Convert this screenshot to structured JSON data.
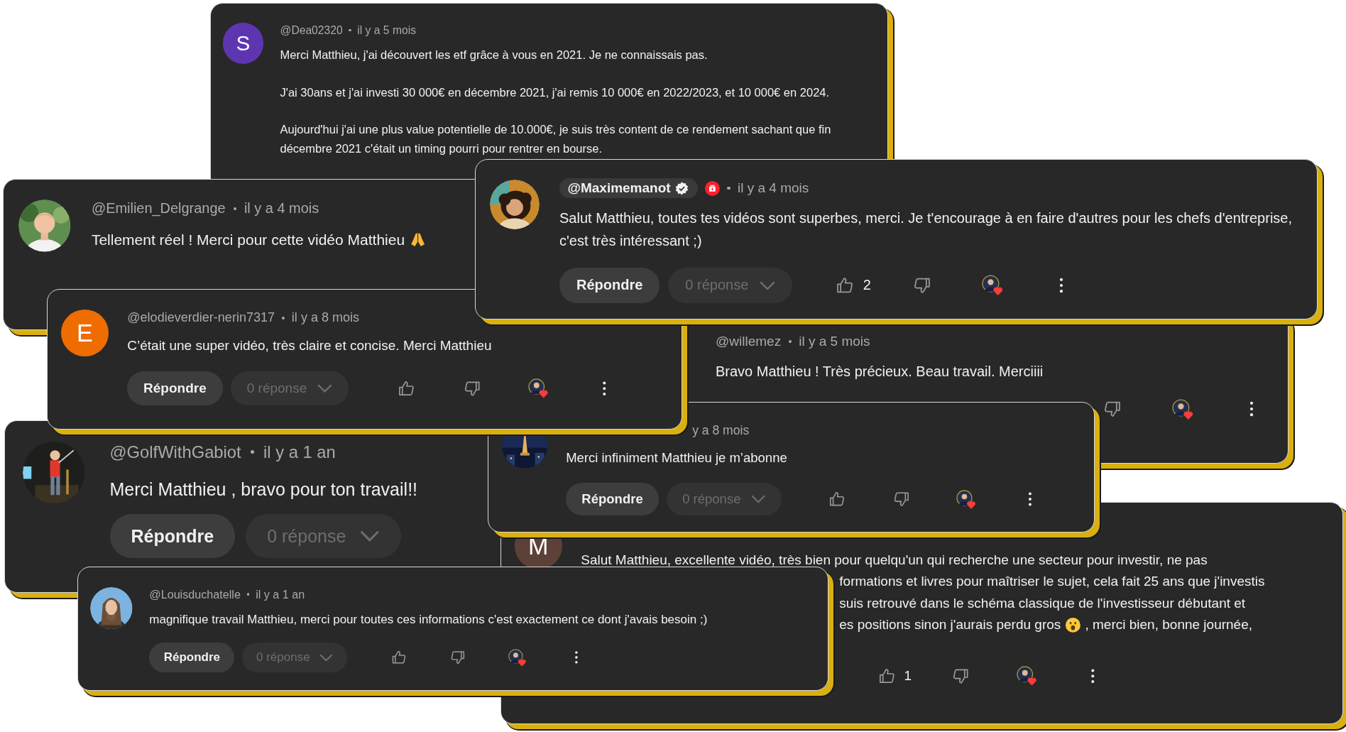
{
  "comments": [
    {
      "avatar": {
        "kind": "letter",
        "letter": "S",
        "color": "#5e35b1"
      },
      "author": "@Dea02320",
      "time": "il y a 5 mois",
      "paragraphs": [
        "Merci Matthieu, j'ai découvert les etf grâce à vous en 2021. Je ne connaissais pas.",
        "J'ai 30ans et j'ai investi 30 000€ en décembre 2021, j'ai remis 10 000€ en 2022/2023, et 10 000€ en 2024.",
        "Aujourd'hui j'ai une plus value potentielle de 10.000€, je suis très content de ce rendement sachant que fin décembre 2021 c'était un timing pourri pour rentrer en bourse."
      ]
    },
    {
      "avatar": {
        "kind": "picture"
      },
      "author": "@Maximemanot",
      "author_highlighted": true,
      "verified": true,
      "member": true,
      "time": "il y a 4 mois",
      "paragraphs": [
        "Salut Matthieu, toutes tes vidéos sont superbes, merci. Je t'encourage à en faire d'autres pour les chefs d'entreprise, c'est très intéressant ;)"
      ],
      "actions": {
        "reply": "Répondre",
        "replies": "0 réponse",
        "likes": "2",
        "creator_heart": true
      }
    },
    {
      "avatar": {
        "kind": "picture"
      },
      "author": "@Emilien_Delgrange",
      "time": "il y a 4 mois",
      "lines": [
        [
          {
            "kind": "text",
            "text": "Tellement réel ! Merci pour cette vidéo Matthieu"
          },
          {
            "kind": "emoji"
          }
        ]
      ]
    },
    {
      "avatar": {
        "kind": "letter",
        "letter": "E",
        "color": "#ef6c00"
      },
      "author": "@elodieverdier-nerin7317",
      "time": "il y a 8 mois",
      "paragraphs": [
        "C’était une super vidéo, très claire et concise. Merci Matthieu"
      ],
      "actions": {
        "reply": "Répondre",
        "replies": "0 réponse",
        "creator_heart": true
      }
    },
    {
      "author": "@willemez",
      "time": "il y a 5 mois",
      "paragraphs": [
        "Bravo Matthieu ! Très précieux. Beau travail. Merciiii"
      ],
      "actions": {
        "creator_heart": true
      }
    },
    {
      "avatar": {
        "kind": "picture"
      },
      "time": "y a 8 mois",
      "paragraphs": [
        "Merci infiniment Matthieu je m’abonne"
      ],
      "actions": {
        "reply": "Répondre",
        "replies": "0 réponse",
        "creator_heart": true
      }
    },
    {
      "avatar": {
        "kind": "picture"
      },
      "author": "@GolfWithGabiot",
      "time": "il y a 1 an",
      "paragraphs": [
        "Merci Matthieu , bravo pour ton travail!!"
      ],
      "actions": {
        "reply": "Répondre",
        "replies": "0 réponse"
      }
    },
    {
      "avatar": {
        "kind": "letter",
        "letter": "M",
        "color": "#5d4037"
      },
      "lines": [
        [
          {
            "kind": "text",
            "text": "Salut Matthieu, excellente vidéo, très bien pour quelqu'un qui recherche une secteur pour investir, ne pas"
          }
        ],
        [
          {
            "kind": "text",
            "text": "formations et livres pour maîtriser le sujet, cela fait 25 ans que j'investis"
          }
        ],
        [
          {
            "kind": "text",
            "text": "suis retrouvé dans le schéma classique de l'investisseur débutant et"
          }
        ],
        [
          {
            "kind": "text",
            "text": "es positions sinon j'aurais perdu gros"
          },
          {
            "kind": "emoji"
          },
          {
            "kind": "text",
            "text": ", merci bien, bonne journée,"
          }
        ]
      ],
      "actions": {
        "likes": "1",
        "creator_heart": true
      }
    },
    {
      "avatar": {
        "kind": "picture"
      },
      "author": "@Louisduchatelle",
      "time": "il y a 1 an",
      "paragraphs": [
        "magnifique travail Matthieu, merci pour toutes ces informations c'est exactement ce dont j'avais besoin ;)"
      ],
      "actions": {
        "reply": "Répondre",
        "replies": "0 réponse",
        "creator_heart": true
      }
    }
  ]
}
